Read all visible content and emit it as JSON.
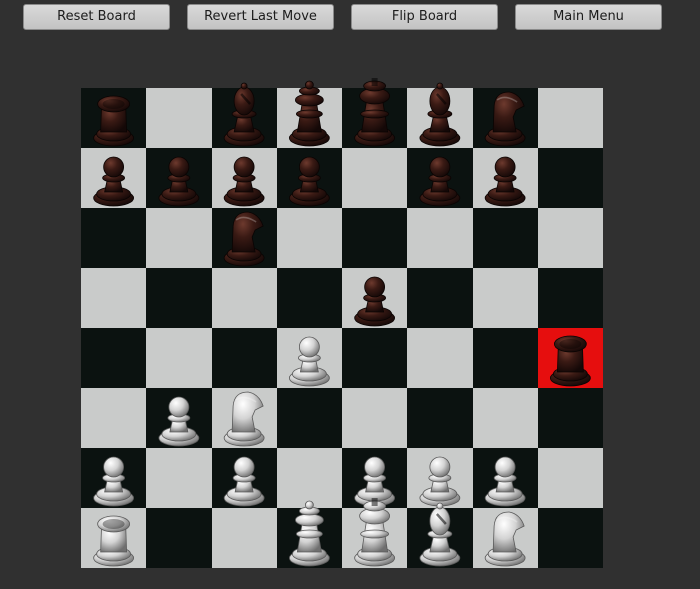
{
  "toolbar": {
    "reset_label": "Reset Board",
    "revert_label": "Revert Last Move",
    "flip_label": "Flip Board",
    "menu_label": "Main Menu"
  },
  "board": {
    "light_color": "#c9cbca",
    "dark_color": "#0b1210",
    "highlight_color": "#e60e0e",
    "highlight_square": "h4",
    "orientation": "white-bottom",
    "pieces": [
      {
        "sq": "a8",
        "type": "rook",
        "color": "black"
      },
      {
        "sq": "c8",
        "type": "bishop",
        "color": "black"
      },
      {
        "sq": "d8",
        "type": "queen",
        "color": "black"
      },
      {
        "sq": "e8",
        "type": "king",
        "color": "black"
      },
      {
        "sq": "f8",
        "type": "bishop",
        "color": "black"
      },
      {
        "sq": "g8",
        "type": "knight",
        "color": "black"
      },
      {
        "sq": "a7",
        "type": "pawn",
        "color": "black"
      },
      {
        "sq": "b7",
        "type": "pawn",
        "color": "black"
      },
      {
        "sq": "c7",
        "type": "pawn",
        "color": "black"
      },
      {
        "sq": "d7",
        "type": "pawn",
        "color": "black"
      },
      {
        "sq": "f7",
        "type": "pawn",
        "color": "black"
      },
      {
        "sq": "g7",
        "type": "pawn",
        "color": "black"
      },
      {
        "sq": "c6",
        "type": "knight",
        "color": "black"
      },
      {
        "sq": "e5",
        "type": "pawn",
        "color": "black"
      },
      {
        "sq": "h4",
        "type": "rook",
        "color": "black"
      },
      {
        "sq": "d4",
        "type": "pawn",
        "color": "white"
      },
      {
        "sq": "b3",
        "type": "pawn",
        "color": "white"
      },
      {
        "sq": "c3",
        "type": "knight",
        "color": "white"
      },
      {
        "sq": "a2",
        "type": "pawn",
        "color": "white"
      },
      {
        "sq": "c2",
        "type": "pawn",
        "color": "white"
      },
      {
        "sq": "e2",
        "type": "pawn",
        "color": "white"
      },
      {
        "sq": "f2",
        "type": "pawn",
        "color": "white"
      },
      {
        "sq": "g2",
        "type": "pawn",
        "color": "white"
      },
      {
        "sq": "a1",
        "type": "rook",
        "color": "white"
      },
      {
        "sq": "d1",
        "type": "queen",
        "color": "white"
      },
      {
        "sq": "e1",
        "type": "king",
        "color": "white"
      },
      {
        "sq": "f1",
        "type": "bishop",
        "color": "white"
      },
      {
        "sq": "g1",
        "type": "knight",
        "color": "white"
      }
    ]
  }
}
